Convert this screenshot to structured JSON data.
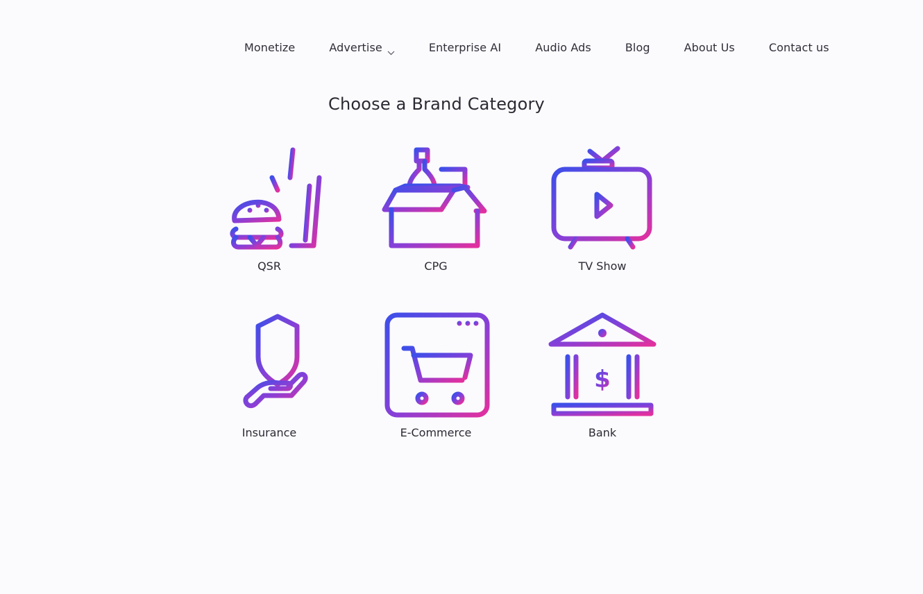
{
  "brand": {
    "logo_icon": "soundwave-logo-icon",
    "gradient": [
      "#3f4ee8",
      "#e0309f"
    ]
  },
  "nav": {
    "items": [
      {
        "label": "Monetize"
      },
      {
        "label": "Advertise",
        "has_dropdown": true
      },
      {
        "label": "Enterprise AI"
      },
      {
        "label": "Audio Ads"
      },
      {
        "label": "Blog"
      },
      {
        "label": "About Us"
      },
      {
        "label": "Contact us"
      }
    ]
  },
  "main": {
    "title": "Choose a Brand Category",
    "categories": [
      {
        "label": "QSR",
        "icon": "burger-and-drink-icon"
      },
      {
        "label": "CPG",
        "icon": "package-box-icon"
      },
      {
        "label": "TV Show",
        "icon": "tv-play-icon"
      },
      {
        "label": "Insurance",
        "icon": "shield-hand-icon"
      },
      {
        "label": "E-Commerce",
        "icon": "browser-cart-icon"
      },
      {
        "label": "Bank",
        "icon": "bank-building-icon"
      }
    ]
  }
}
